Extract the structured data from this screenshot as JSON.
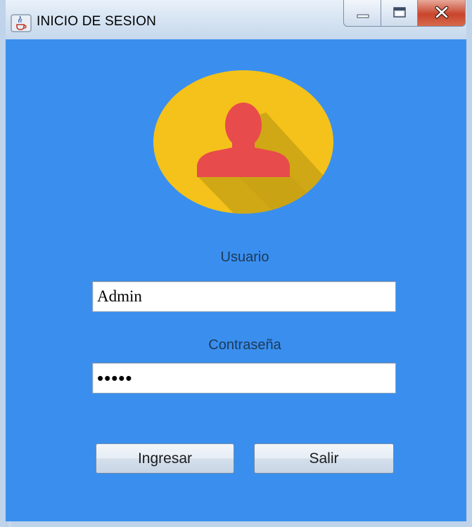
{
  "window": {
    "title": "INICIO DE SESION",
    "icon": "java-cup-icon",
    "controls": [
      "minimize-icon",
      "maximize-icon",
      "close-icon"
    ]
  },
  "colors": {
    "client_background": "#3a8fee",
    "avatar_circle": "#f4c21a",
    "avatar_person": "#e84b4b",
    "label_text": "#1b3a5c"
  },
  "form": {
    "user_label": "Usuario",
    "user_value": "Admin",
    "password_label": "Contraseña",
    "password_value": "•••••",
    "login_button": "Ingresar",
    "exit_button": "Salir"
  }
}
